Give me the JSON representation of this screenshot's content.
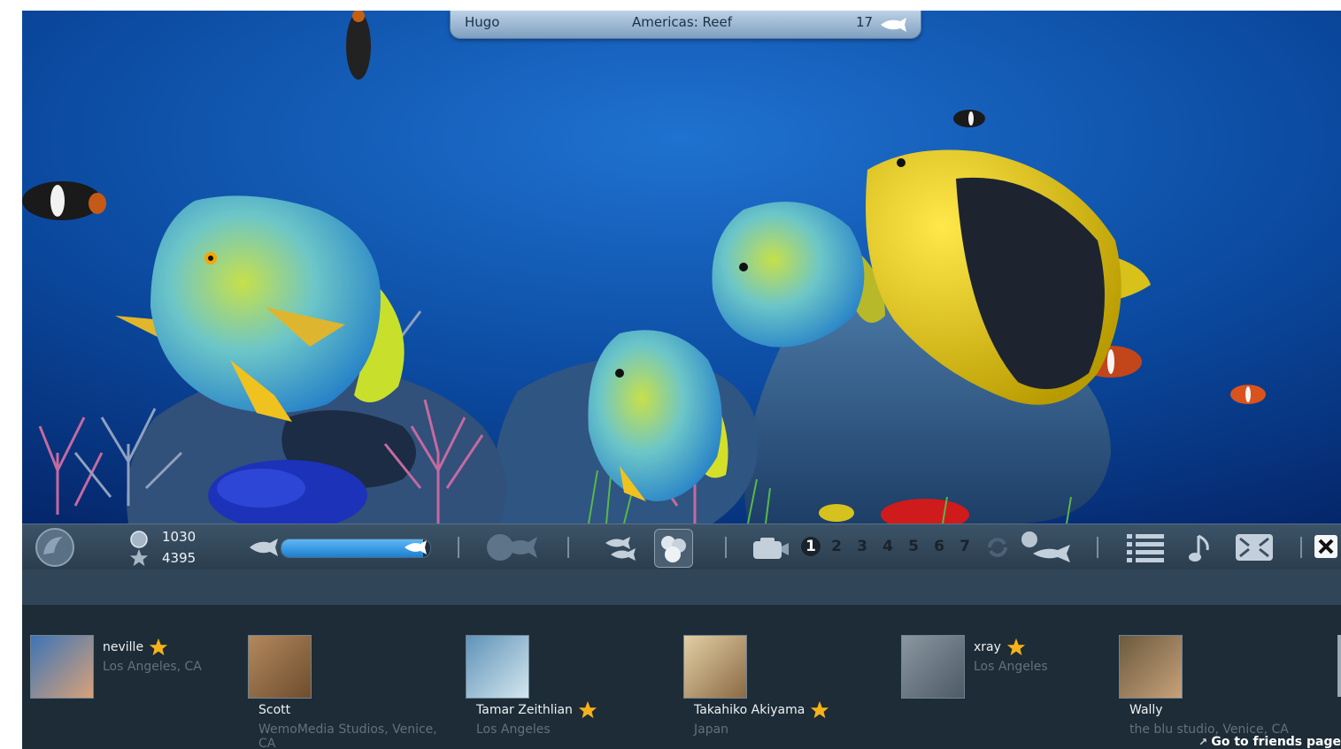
{
  "top_bar": {
    "player": "Hugo",
    "location": "Americas: Reef",
    "fish_count": "17"
  },
  "toolbar": {
    "pearls": "1030",
    "stars": "4395",
    "energy_fraction": 0.95,
    "tank_numbers": [
      "1",
      "2",
      "3",
      "4",
      "5",
      "6",
      "7"
    ],
    "selected_tank": "1"
  },
  "friends": [
    {
      "name": "neville",
      "location": "Los Angeles, CA",
      "starred": true
    },
    {
      "name": "Scott",
      "location": "WemoMedia Studios, Venice, CA",
      "starred": false
    },
    {
      "name": "Tamar Zeithlian",
      "location": "Los Angeles",
      "starred": true
    },
    {
      "name": "Takahiko Akiyama",
      "location": "Japan",
      "starred": true
    },
    {
      "name": "xray",
      "location": "Los Angeles",
      "starred": true
    },
    {
      "name": "Wally",
      "location": "the blu studio, Venice, CA",
      "starred": false
    }
  ],
  "friends_link": "Go to friends page",
  "colors": {
    "water": "#0c3f8a",
    "energy": "#2f9ae6",
    "star": "#f7b21a"
  },
  "icons": [
    "dolphin-icon",
    "pearl-icon",
    "star-icon",
    "fish-icon",
    "fish-outline-icon",
    "school-icon",
    "group-icon",
    "camera-icon",
    "refresh-icon",
    "feed-icon",
    "list-icon",
    "music-icon",
    "fullscreen-icon",
    "close-icon",
    "external-link-icon"
  ]
}
